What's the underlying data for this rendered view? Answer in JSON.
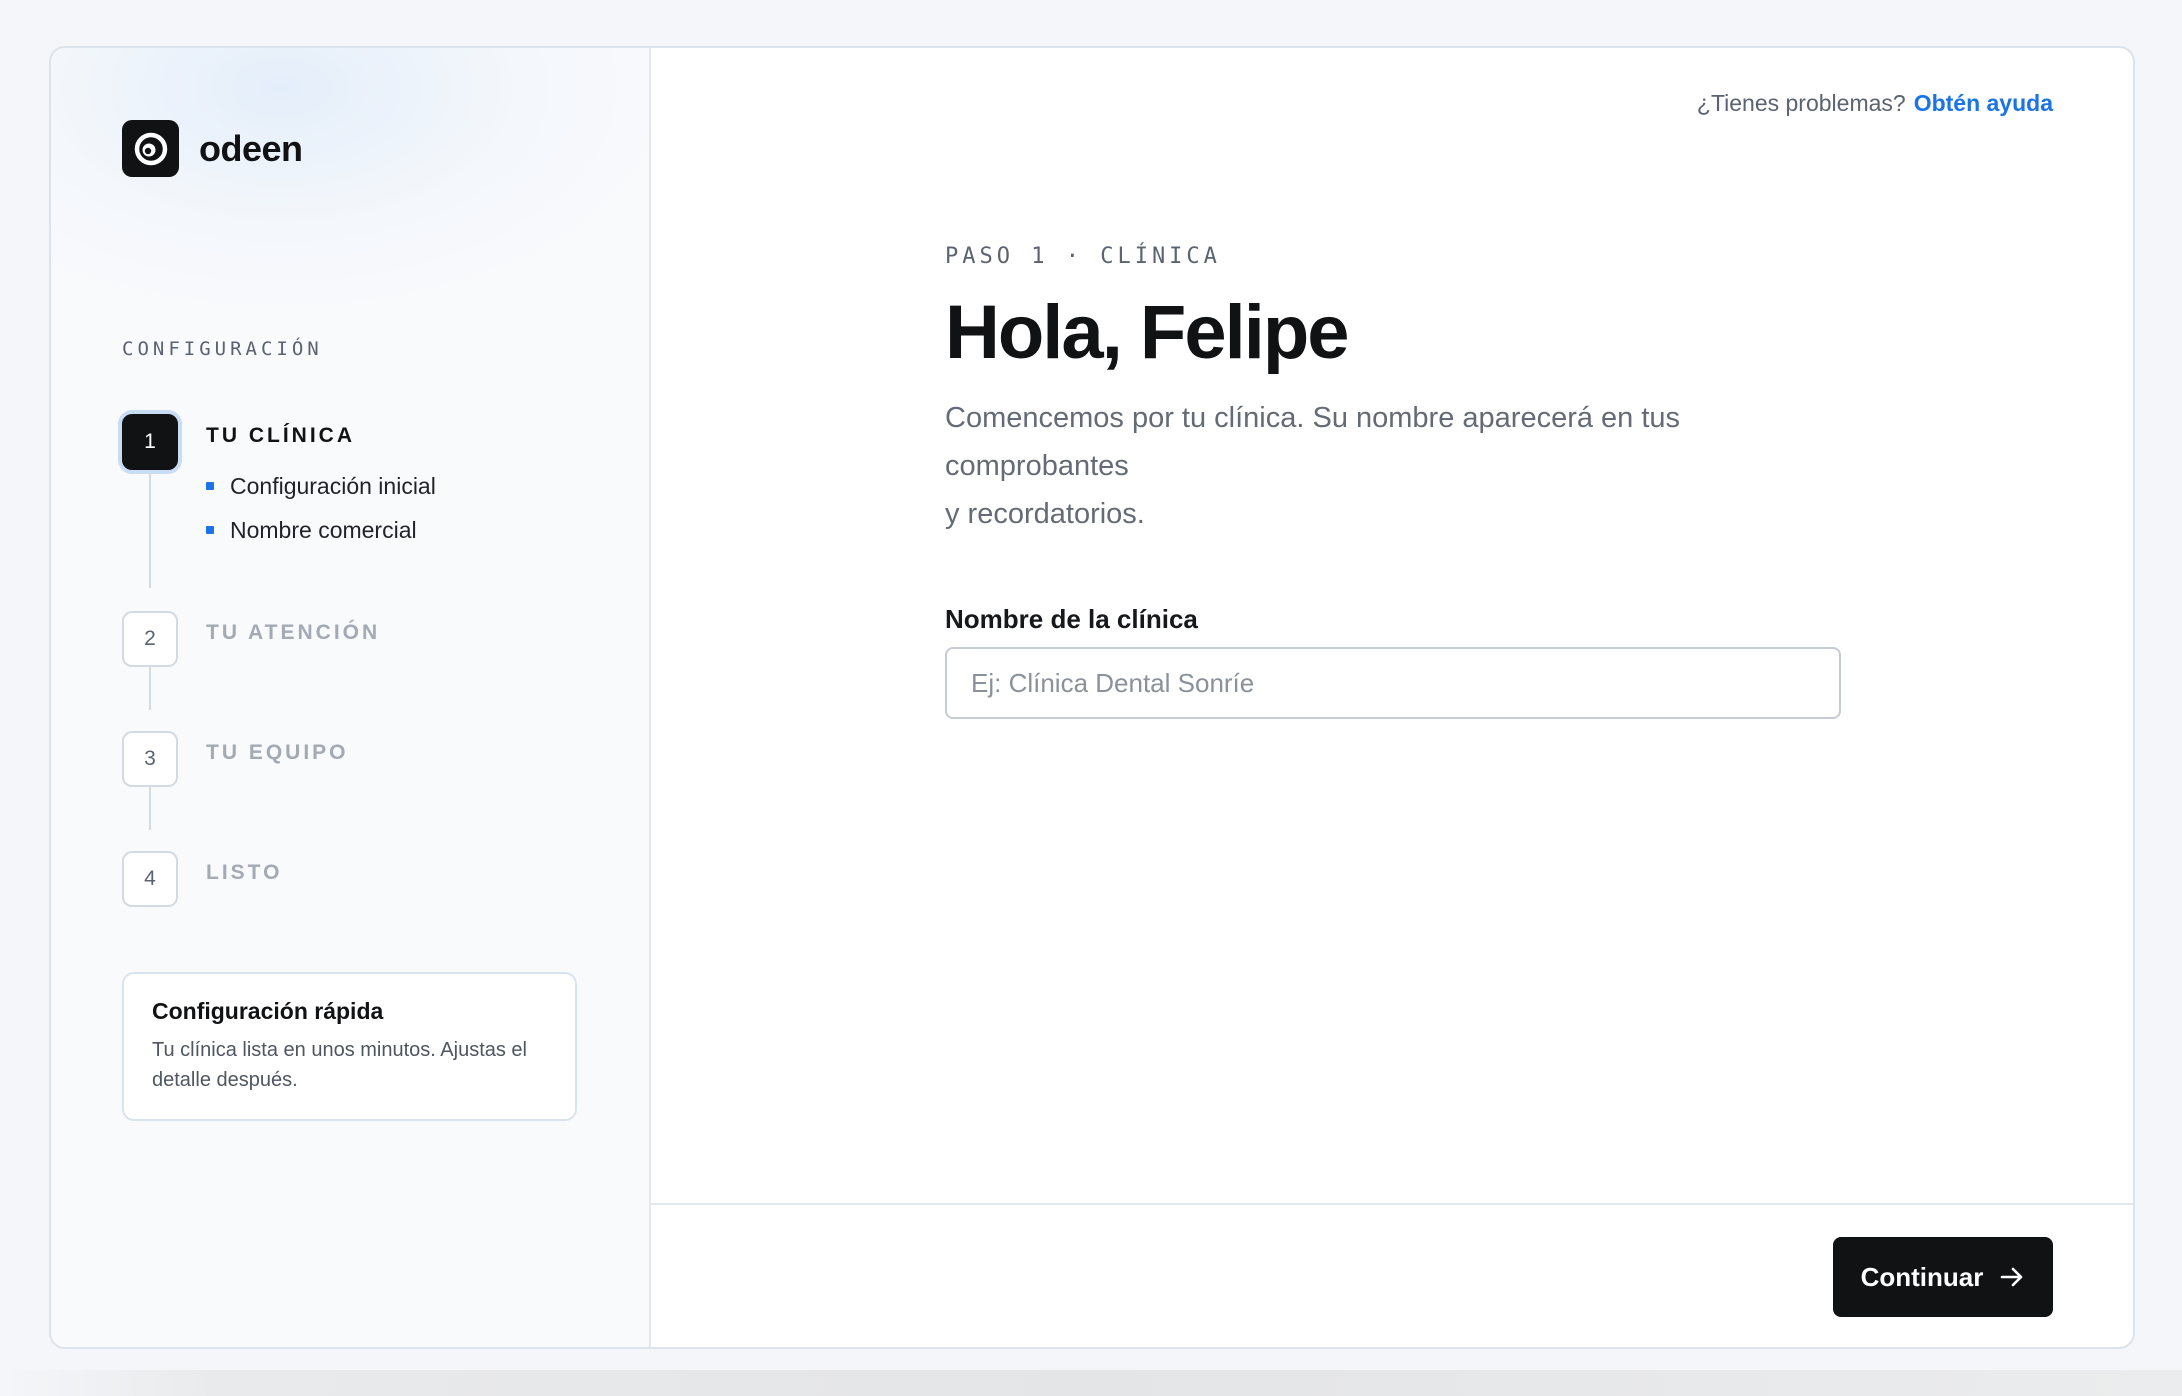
{
  "brand": {
    "name": "odeen"
  },
  "sidebar": {
    "section_label": "CONFIGURACIÓN",
    "steps": [
      {
        "number": "1",
        "title": "TU CLÍNICA",
        "active": true,
        "substeps": [
          {
            "label": "Configuración inicial"
          },
          {
            "label": "Nombre comercial"
          }
        ]
      },
      {
        "number": "2",
        "title": "TU ATENCIÓN",
        "active": false
      },
      {
        "number": "3",
        "title": "TU EQUIPO",
        "active": false
      },
      {
        "number": "4",
        "title": "LISTO",
        "active": false
      }
    ],
    "info_card": {
      "title": "Configuración rápida",
      "text": "Tu clínica lista en unos minutos. Ajustas el detalle después."
    }
  },
  "header": {
    "help_prompt": "¿Tienes problemas?",
    "help_link": "Obtén ayuda"
  },
  "main": {
    "eyebrow": "PASO 1 · CLÍNICA",
    "title": "Hola, Felipe",
    "subtitle_line1": "Comencemos por tu clínica. Su nombre aparecerá en tus comprobantes",
    "subtitle_line2": "y recordatorios.",
    "field": {
      "label": "Nombre de la clínica",
      "value": "",
      "placeholder": "Ej: Clínica Dental Sonríe"
    }
  },
  "footer": {
    "continue_label": "Continuar"
  },
  "colors": {
    "accent": "#1b73e8",
    "primary": "#111214"
  }
}
